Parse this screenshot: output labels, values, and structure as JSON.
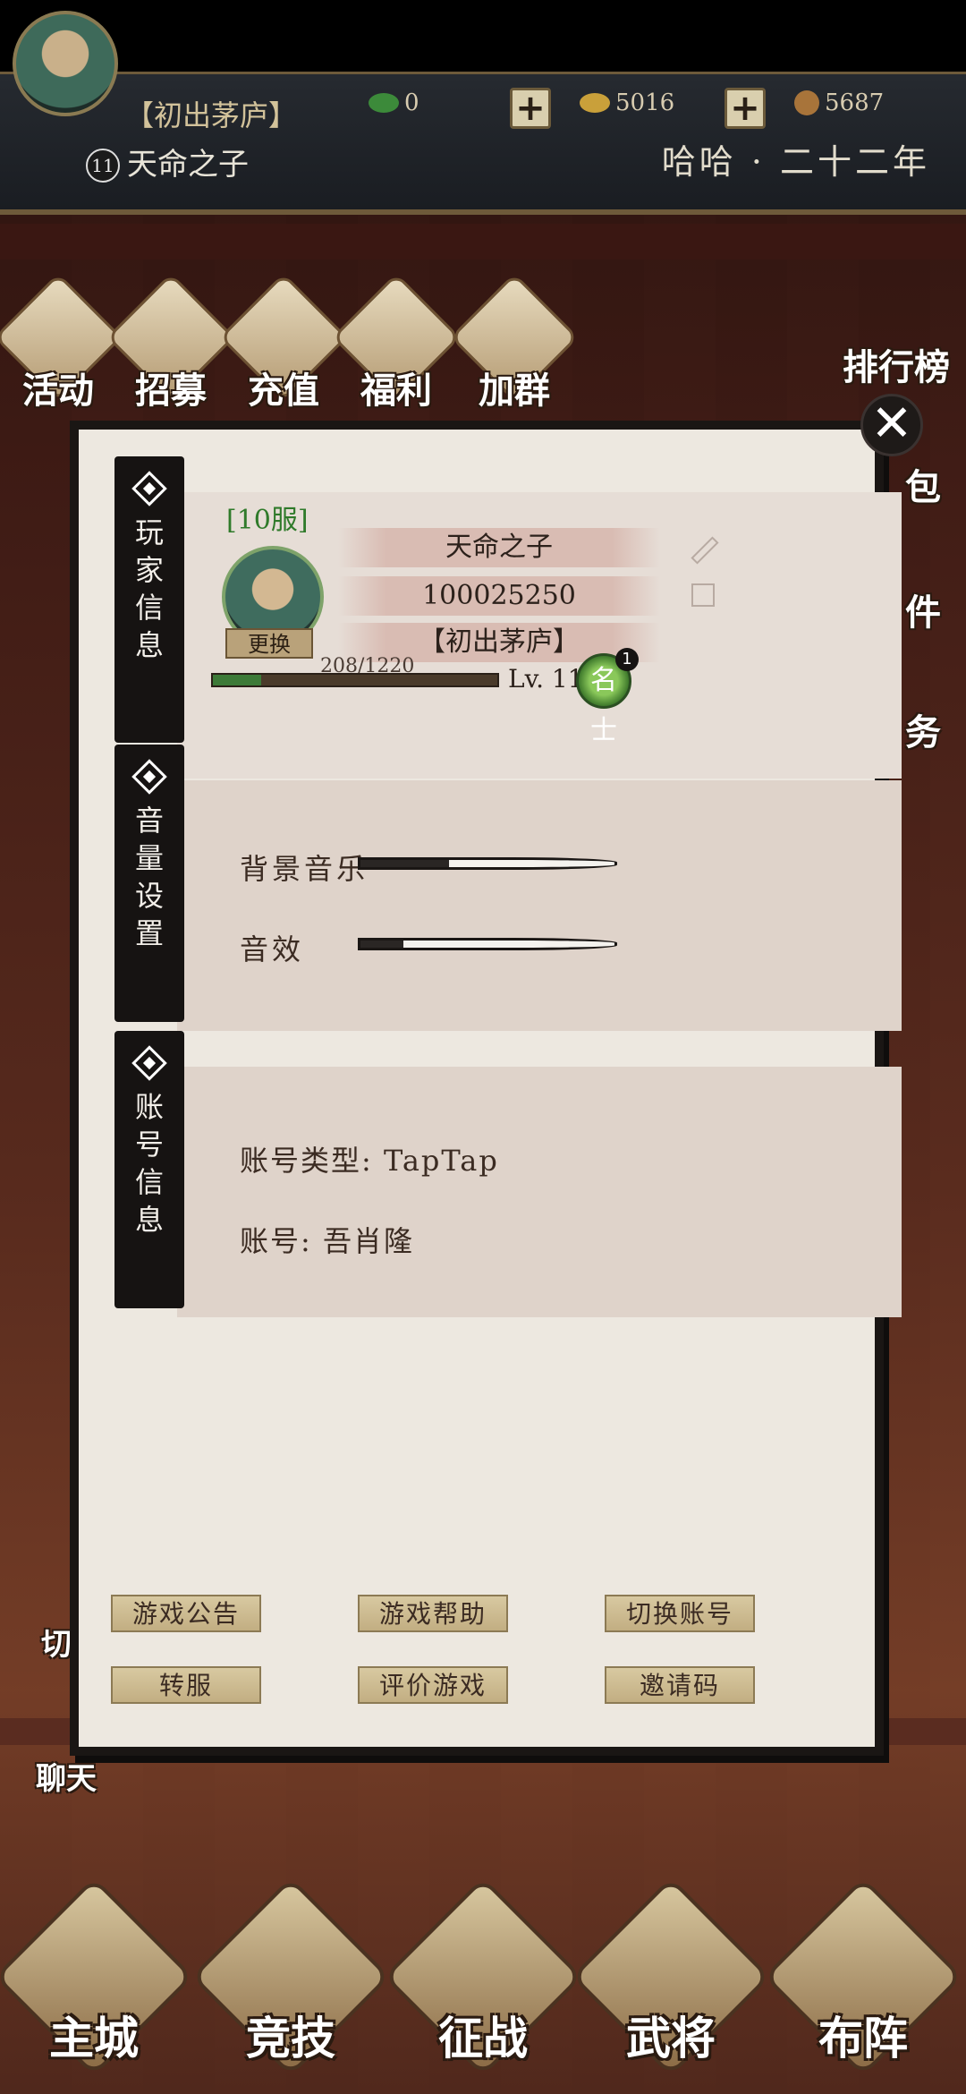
{
  "hud": {
    "level": "11",
    "title": "【初出茅庐】",
    "name": "天命之子",
    "jade": "0",
    "gold": "5016",
    "copper": "5687",
    "era": "哈哈 · 二十二年"
  },
  "features": [
    {
      "label": "活动"
    },
    {
      "label": "招募"
    },
    {
      "label": "充值"
    },
    {
      "label": "福利"
    },
    {
      "label": "加群"
    }
  ],
  "right_side": {
    "rank": "排行榜",
    "pack_partial": "包",
    "mail_partial": "件",
    "task_partial": "务"
  },
  "player": {
    "tab": [
      "玩",
      "家",
      "信",
      "息"
    ],
    "server": "[10服]",
    "change": "更换",
    "name": "天命之子",
    "id": "100025250",
    "title": "【初出茅庐】",
    "exp": "208/1220",
    "exp_fraction": 0.17,
    "level": "Lv. 11",
    "badge": "名士",
    "badge_count": "1"
  },
  "volume": {
    "tab": [
      "音",
      "量",
      "设",
      "置"
    ],
    "music_label": "背景音乐",
    "music_level": 0.35,
    "sfx_label": "音效",
    "sfx_level": 0.17
  },
  "account": {
    "tab": [
      "账",
      "号",
      "信",
      "息"
    ],
    "type_line": "账号类型: TapTap",
    "account_line": "账号: 吾肖隆"
  },
  "buttons": {
    "announce": "游戏公告",
    "help": "游戏帮助",
    "switch_account": "切换账号",
    "transfer": "转服",
    "rate": "评价游戏",
    "invite": "邀请码"
  },
  "side_left": {
    "chat": "聊天",
    "cut_partial": "切"
  },
  "nav": {
    "city": "主城",
    "arena": "竞技",
    "campaign": "征战",
    "generals": "武将",
    "formation": "布阵"
  },
  "colors": {
    "accent_green": "#3d7a38",
    "modal_bg": "#ede8e0",
    "ink": "#161312"
  }
}
